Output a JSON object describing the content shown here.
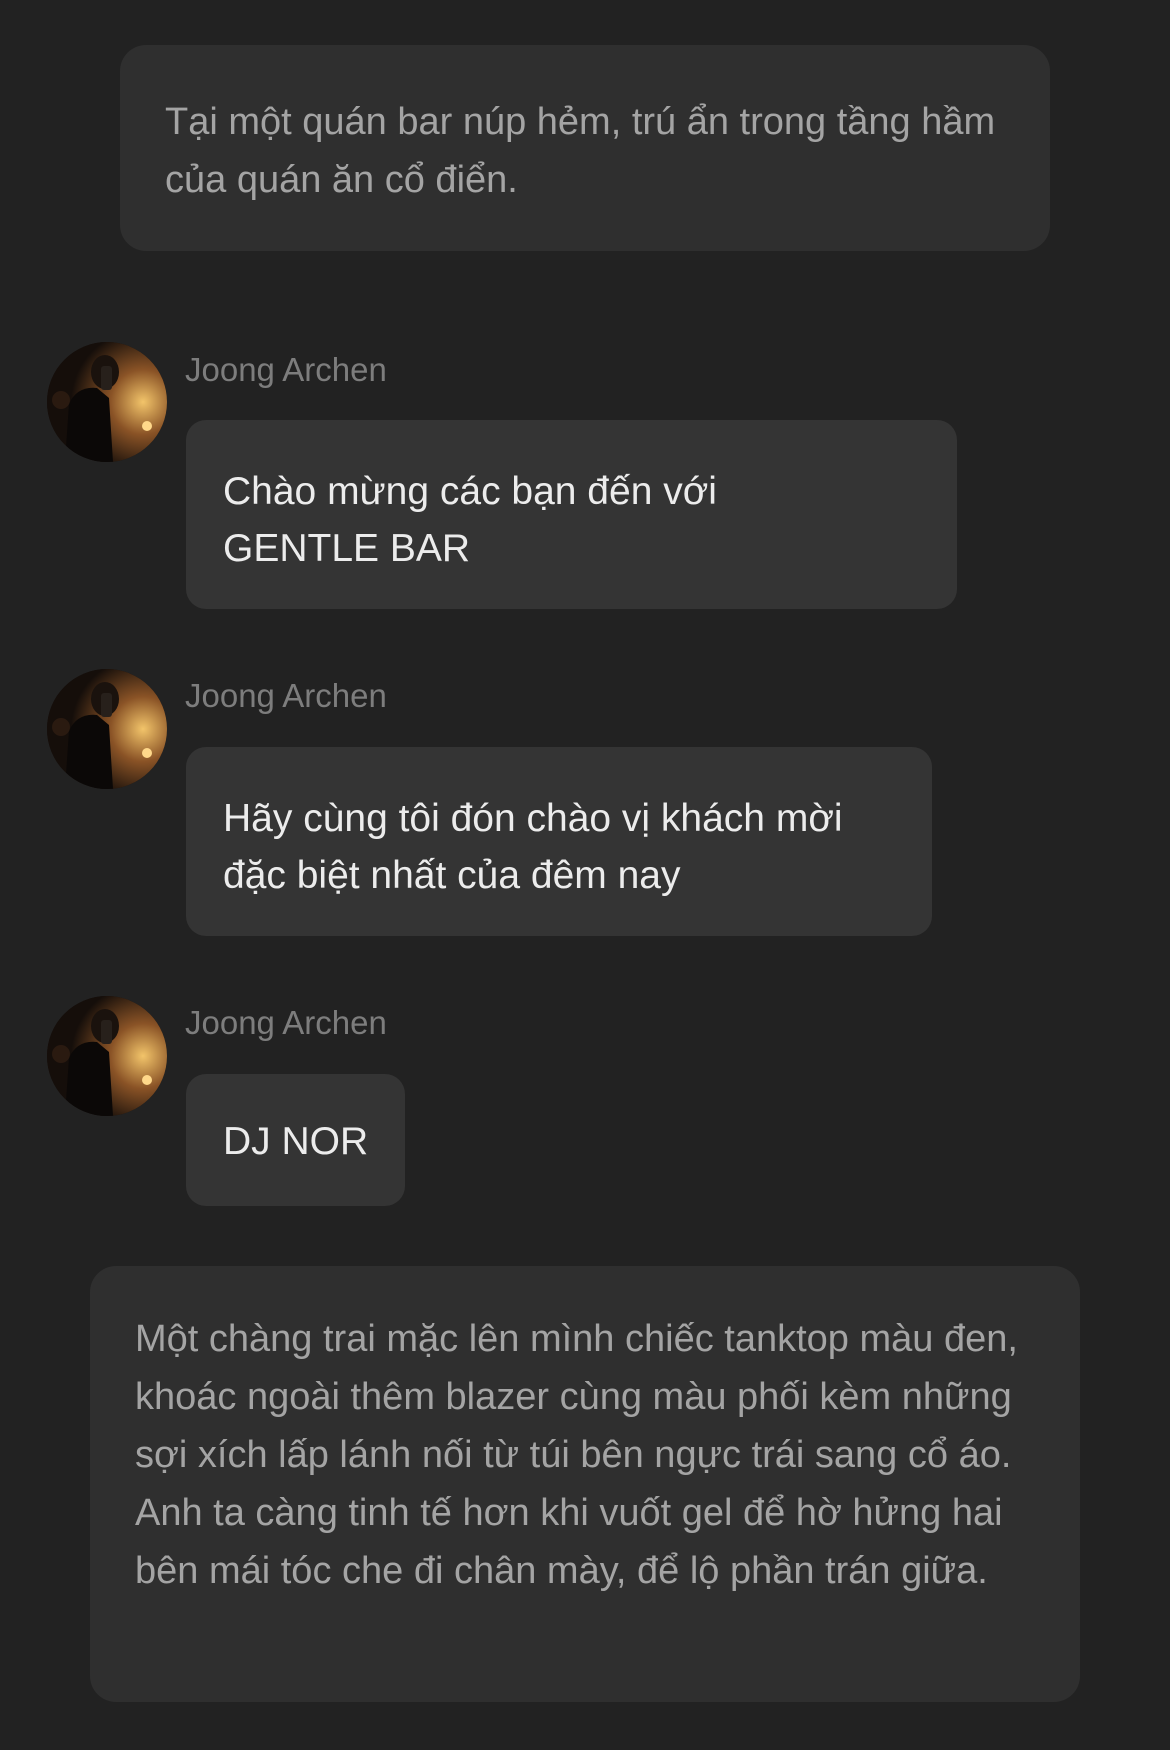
{
  "chat": {
    "narration_1": "Tại một quán bar núp hẻm, trú ẩn trong tầng hầm của quán ăn cổ điển.",
    "messages": [
      {
        "sender": "Joong Archen",
        "text_lines": [
          "Chào mừng các bạn đến với",
          "GENTLE BAR"
        ]
      },
      {
        "sender": "Joong Archen",
        "text_lines": [
          "Hãy cùng tôi đón chào vị khách mời",
          "đặc biệt nhất của đêm nay"
        ]
      },
      {
        "sender": "Joong Archen",
        "text_lines": [
          "DJ NOR"
        ]
      }
    ],
    "narration_2": "Một chàng trai mặc lên mình chiếc tanktop màu đen, khoác ngoài thêm blazer cùng màu phối kèm những sợi xích lấp lánh nối từ túi bên ngực trái sang cổ áo. Anh ta càng tinh tế hơn khi vuốt gel để hờ hửng hai bên mái tóc che đi chân mày, để lộ phần trán giữa."
  },
  "colors": {
    "background": "#222222",
    "narration_bg": "#2f2f2f",
    "bubble_bg": "#343434",
    "narration_text": "#a4a4a4",
    "message_text": "#ececec",
    "sender_text": "#7d7d7d"
  }
}
